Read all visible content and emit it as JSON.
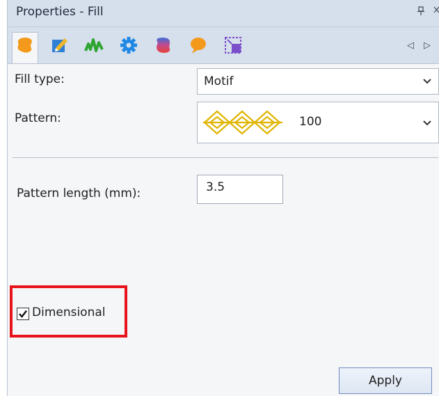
{
  "panel": {
    "title": "Properties - Fill",
    "pin_glyph": "¤",
    "close_glyph": "✕"
  },
  "tabs": [
    {
      "name": "fill-shape-icon",
      "color": "#f39a1c",
      "active": true
    },
    {
      "name": "outline-edit-icon",
      "color": "#2f7fd6",
      "active": false
    },
    {
      "name": "stitch-wave-icon",
      "color": "#2fa531",
      "active": false
    },
    {
      "name": "gear-icon",
      "color": "#1e88e5",
      "active": false
    },
    {
      "name": "gradient-blend-icon",
      "color": "#d0406b",
      "active": false
    },
    {
      "name": "speech-bubble-icon",
      "color": "#f39a1c",
      "active": false
    },
    {
      "name": "resize-frame-icon",
      "color": "#7b4fc9",
      "active": false
    }
  ],
  "nav": {
    "prev": "◁",
    "next": "▷"
  },
  "fill_type": {
    "label": "Fill type:",
    "value": "Motif"
  },
  "pattern": {
    "label": "Pattern:",
    "value": "100"
  },
  "pattern_length": {
    "label": "Pattern length (mm):",
    "value": "3.5"
  },
  "dimensional": {
    "label": "Dimensional",
    "checked": true
  },
  "apply_label": "Apply",
  "colors": {
    "highlight": "#e8141b",
    "pattern_motif": "#e0b400"
  }
}
